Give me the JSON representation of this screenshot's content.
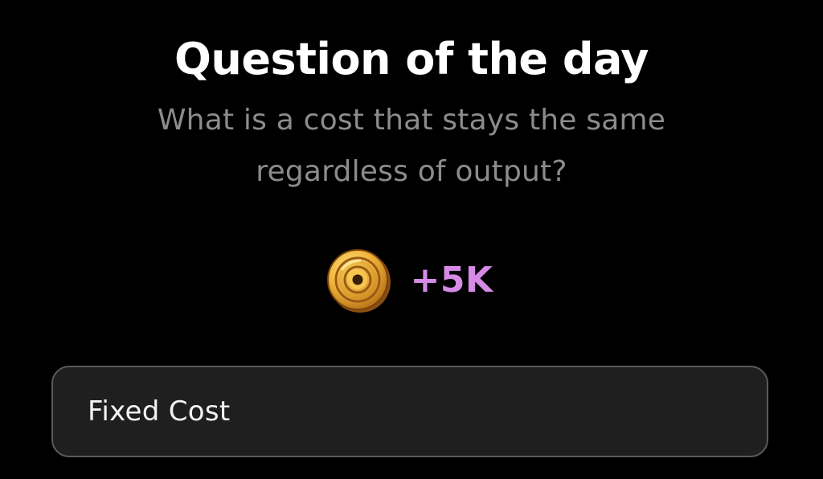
{
  "header": {
    "title": "Question of the day"
  },
  "question": {
    "text": "What is a cost that stays the same regardless of output?"
  },
  "reward": {
    "icon": "coin-icon",
    "amount": "+5K",
    "color": "#d58ae6"
  },
  "answer": {
    "value": "Fixed Cost"
  },
  "colors": {
    "background": "#000000",
    "title": "#ffffff",
    "question": "#8c8c8c",
    "field_background": "#1f1f1f",
    "field_border": "#5a5a5a",
    "coin": "#e2a93b"
  }
}
